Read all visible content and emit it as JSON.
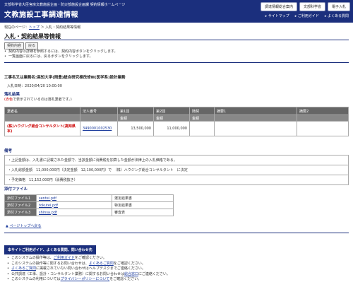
{
  "header": {
    "subtitle": "文部科学省大臣官房文教施設企画・防災部施設企画課 契約情報ホームページ",
    "title": "文教施設工事調達情報",
    "buttons": [
      "調達情報総合案内",
      "文部科学省",
      "電子入札"
    ],
    "nav": [
      "サイトマップ",
      "ご利用ガイド",
      "よくある質問"
    ]
  },
  "breadcrumb": {
    "prefix": "現在のページ：",
    "top": "トップ",
    "sep": "＞",
    "current": "入札・契約結果等情報"
  },
  "page_title": "入札・契約結果等情報",
  "buttons": {
    "contract": "契約内容",
    "back": "戻る"
  },
  "notes": [
    "契約内容の詳細を参照するには、契約内容ボタンをクリックします。",
    "一覧画面に戻るには、戻るボタンをクリックします。"
  ],
  "project": {
    "name": "工事名又は業務名:高知大学(岡豊)総合研究棟改修Ⅲ(医学系)設計業務",
    "date_label": "入札日時：",
    "date": "2020/04/20 10:00:00"
  },
  "result": {
    "section_title": "落札結果",
    "legend_red": "(赤色",
    "legend_rest": "で表示されているのは落札業者です。)",
    "headers": [
      "業者名",
      "法人番号",
      "第1回",
      "第2回",
      "随契",
      "摘要1",
      "摘要2"
    ],
    "subheaders": [
      "金額",
      "金額",
      "金額"
    ],
    "row": {
      "bidder": "(株)ハウジング総合コンサルタント(高知県本)",
      "corp_no": "3490001002530",
      "round1": "13,500,000",
      "round2": "11,000,000"
    }
  },
  "bikou": {
    "section_title": "備考",
    "lines": [
      "・上記金額は、入札書に記載された金額で、当該金額に消費税を加算した金額が法律上の入札価格である。",
      "・入札総額金額　11,000,000円（決定金額　12,100,000円）で　（株）ハウジング総合コンサルタント　に決定",
      "・予定価格　11,152,000円（消費税抜き）"
    ]
  },
  "attachments": {
    "section_title": "添付ファイル",
    "items": [
      {
        "label": "添付ファイル1",
        "file": "sentei.pdf",
        "desc": "選定結果書"
      },
      {
        "label": "添付ファイル2",
        "file": "tokutei.pdf",
        "desc": "特定結果書"
      },
      {
        "label": "添付ファイル3",
        "file": "shinsa.pdf",
        "desc": "審査表"
      }
    ]
  },
  "page_top": "ページトップへ戻る",
  "footer": {
    "heading": "本サイトご利用ガイド、よくある質問、問い合わせ先",
    "items": [
      {
        "pre": "このシステムの操作等は、",
        "link": "ご利用ガイド",
        "post": "をご確認ください。"
      },
      {
        "pre": "このシステムの操作等に関するお問い合わせは、",
        "link": "よくあるご質問",
        "post": "をご確認ください。"
      },
      {
        "pre": "",
        "link": "よくあるご質問",
        "post": "に掲載されていない問い合わせはヘルプデスクまでご連絡ください。"
      },
      {
        "pre": "公共調達（工事、設計・コンサルタント業務）に関するお問い合わせは",
        "link": "総合窓口",
        "post": "にご連絡ください。"
      },
      {
        "pre": "このシステムの利用については",
        "link": "プライバシーポリシーについて",
        "post": "をご確認ください。"
      }
    ]
  }
}
